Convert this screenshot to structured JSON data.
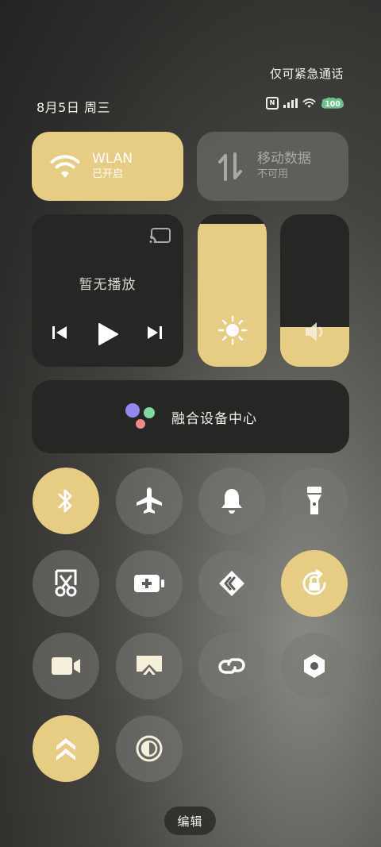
{
  "status_bar": {
    "emergency_text": "仅可紧急通话",
    "date_text": "8月5日 周三",
    "battery_level": "100"
  },
  "wlan_tile": {
    "title": "WLAN",
    "status": "已开启",
    "state": "on"
  },
  "mobile_tile": {
    "title": "移动数据",
    "status": "不可用",
    "state": "disabled"
  },
  "media_card": {
    "title": "暂无播放"
  },
  "brightness": {
    "level": 0.94
  },
  "volume": {
    "level": 0.26
  },
  "fusion_card": {
    "label": "融合设备中心"
  },
  "toggles": [
    {
      "icon": "bluetooth-icon",
      "state": "on"
    },
    {
      "icon": "airplane-icon",
      "state": "off"
    },
    {
      "icon": "bell-icon",
      "state": "off"
    },
    {
      "icon": "flashlight-icon",
      "state": "off"
    },
    {
      "icon": "screenshot-scissors-icon",
      "state": "off"
    },
    {
      "icon": "battery-saver-icon",
      "state": "off"
    },
    {
      "icon": "share-icon",
      "state": "off"
    },
    {
      "icon": "rotation-lock-icon",
      "state": "on"
    },
    {
      "icon": "video-camera-icon",
      "state": "off"
    },
    {
      "icon": "screen-cast-icon",
      "state": "off"
    },
    {
      "icon": "link-icon",
      "state": "off"
    },
    {
      "icon": "hexagon-nut-icon",
      "state": "off"
    },
    {
      "icon": "chevrons-up-icon",
      "state": "on"
    },
    {
      "icon": "contrast-icon",
      "state": "off"
    }
  ],
  "edit_button": {
    "label": "编辑"
  },
  "colors": {
    "accent": "#e7cd84",
    "tile_dark": "#262625",
    "tile_inactive": "#6e6e6a"
  }
}
